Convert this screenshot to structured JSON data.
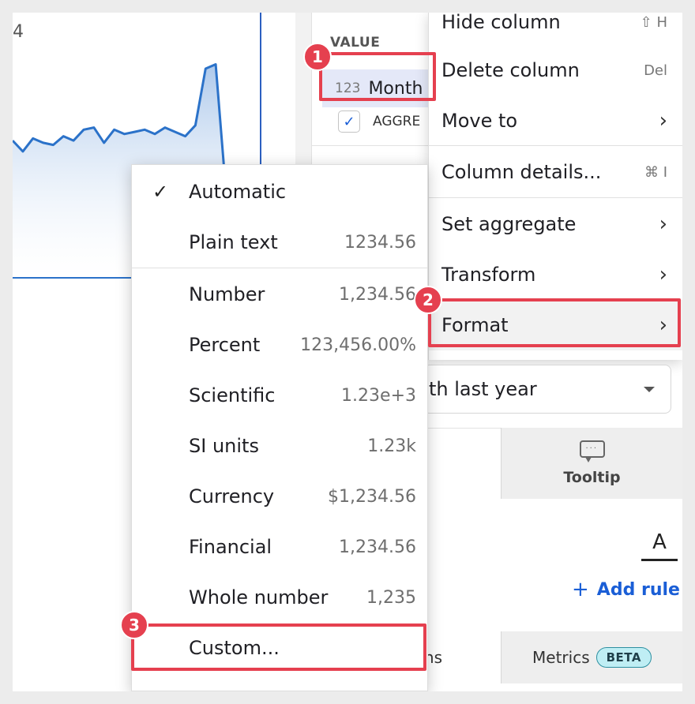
{
  "chart": {
    "edge_label": "4",
    "area_values": [
      63,
      58,
      64,
      62,
      61,
      65,
      63,
      68,
      69,
      62,
      68,
      66,
      67,
      68,
      66,
      69,
      67,
      65,
      70,
      96,
      98,
      40
    ],
    "line_color": "#2b72c9",
    "fill_top_color": "#a9c6ea"
  },
  "panel": {
    "value_header": "VALUE",
    "field_type": "123",
    "field_name": "Month",
    "agg_label": "AGGRE"
  },
  "column_menu": {
    "items": [
      {
        "label": "Hide column",
        "shortcut": "⇧ H",
        "chevron": false
      },
      {
        "label": "Delete column",
        "shortcut": "Del",
        "chevron": false
      },
      {
        "label": "Move to",
        "shortcut": "",
        "chevron": true
      },
      {
        "label": "Column details...",
        "shortcut": "⌘ I",
        "chevron": false
      },
      {
        "label": "Set aggregate",
        "shortcut": "",
        "chevron": true
      },
      {
        "label": "Transform",
        "shortcut": "",
        "chevron": true
      },
      {
        "label": "Format",
        "shortcut": "",
        "chevron": true
      }
    ],
    "chevron_glyph": "›"
  },
  "dropdown": {
    "value": "th last year"
  },
  "tabs": {
    "tooltip_label": "Tooltip"
  },
  "formatting": {
    "font_glyph": "A",
    "add_rule_label": "Add rule",
    "add_rule_plus": "+"
  },
  "bottom_tabs": {
    "left_label": "ns",
    "metrics_label": "Metrics",
    "beta_label": "BETA"
  },
  "format_menu": {
    "check_glyph": "✓",
    "items": [
      {
        "label": "Automatic",
        "example": "",
        "checked": true
      },
      {
        "label": "Plain text",
        "example": "1234.56",
        "checked": false
      },
      {
        "label": "Number",
        "example": "1,234.56",
        "checked": false
      },
      {
        "label": "Percent",
        "example": "123,456.00%",
        "checked": false
      },
      {
        "label": "Scientific",
        "example": "1.23e+3",
        "checked": false
      },
      {
        "label": "SI units",
        "example": "1.23k",
        "checked": false
      },
      {
        "label": "Currency",
        "example": "$1,234.56",
        "checked": false
      },
      {
        "label": "Financial",
        "example": "1,234.56",
        "checked": false
      },
      {
        "label": "Whole number",
        "example": "1,235",
        "checked": false
      },
      {
        "label": "Custom...",
        "example": "",
        "checked": false
      }
    ]
  },
  "callouts": {
    "one": "1",
    "two": "2",
    "three": "3",
    "color": "#e5404f"
  }
}
